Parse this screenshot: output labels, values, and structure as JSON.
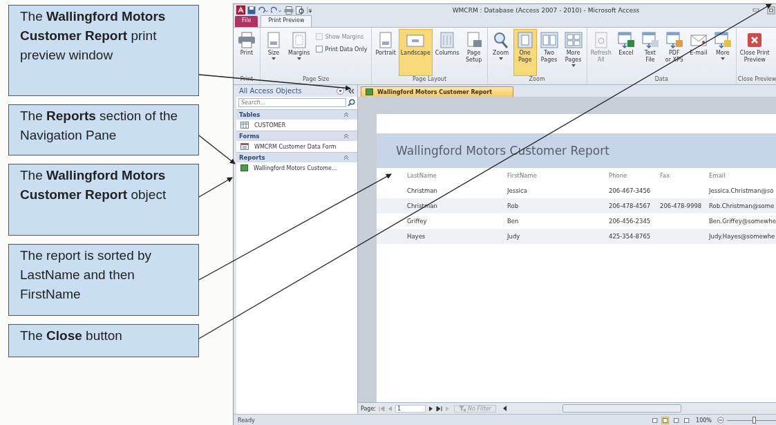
{
  "callouts": [
    {
      "text": "The **Wallingford Motors Customer Report** print preview window"
    },
    {
      "text": "The **Reports** section of the Navigation Pane"
    },
    {
      "text": "The **Wallingford Motors Customer Report** object"
    },
    {
      "text": "The report is sorted by LastName and then FirstName"
    },
    {
      "text": "The **Close** button"
    }
  ],
  "window": {
    "title": "WMCRM : Database (Access 2007 - 2010) - Microsoft Access"
  },
  "tabs": [
    {
      "label": "File",
      "kind": "file",
      "selected": false
    },
    {
      "label": "Print Preview",
      "kind": "ribbon",
      "selected": true
    }
  ],
  "ribbon_groups": [
    {
      "label": "Print",
      "items": [
        {
          "kind": "large",
          "label": "Print",
          "selected": false,
          "disabled": false,
          "menu": false
        }
      ]
    },
    {
      "label": "Page Size",
      "items": [
        {
          "kind": "large",
          "label": "Size",
          "selected": false,
          "disabled": false,
          "menu": true
        },
        {
          "kind": "large",
          "label": "Margins",
          "selected": false,
          "disabled": false,
          "menu": true
        },
        {
          "kind": "check",
          "label": "Show Margins",
          "checked": false,
          "disabled": true
        },
        {
          "kind": "check",
          "label": "Print Data Only",
          "checked": false,
          "disabled": false
        }
      ]
    },
    {
      "label": "Page Layout",
      "items": [
        {
          "kind": "large",
          "label": "Portrait",
          "selected": false,
          "disabled": false,
          "menu": false
        },
        {
          "kind": "large",
          "label": "Landscape",
          "selected": true,
          "disabled": false,
          "menu": false
        },
        {
          "kind": "large",
          "label": "Columns",
          "selected": false,
          "disabled": false,
          "menu": false
        },
        {
          "kind": "large",
          "label": "Page\nSetup",
          "selected": false,
          "disabled": false,
          "menu": false
        }
      ]
    },
    {
      "label": "Zoom",
      "items": [
        {
          "kind": "large",
          "label": "Zoom",
          "selected": false,
          "disabled": false,
          "menu": true
        },
        {
          "kind": "large",
          "label": "One\nPage",
          "selected": true,
          "disabled": false,
          "menu": false
        },
        {
          "kind": "large",
          "label": "Two\nPages",
          "selected": false,
          "disabled": false,
          "menu": false
        },
        {
          "kind": "large",
          "label": "More\nPages",
          "selected": false,
          "disabled": false,
          "menu": true
        }
      ]
    },
    {
      "label": "Data",
      "items": [
        {
          "kind": "large",
          "label": "Refresh\nAll",
          "selected": false,
          "disabled": true,
          "menu": false
        },
        {
          "kind": "large",
          "label": "Excel",
          "selected": false,
          "disabled": false,
          "menu": false
        },
        {
          "kind": "large",
          "label": "Text\nFile",
          "selected": false,
          "disabled": false,
          "menu": false
        },
        {
          "kind": "large",
          "label": "PDF\nor XPS",
          "selected": false,
          "disabled": false,
          "menu": false
        },
        {
          "kind": "large",
          "label": "E-mail",
          "selected": false,
          "disabled": false,
          "menu": false
        },
        {
          "kind": "large",
          "label": "More",
          "selected": false,
          "disabled": false,
          "menu": true
        }
      ]
    },
    {
      "label": "Close Preview",
      "items": [
        {
          "kind": "large",
          "label": "Close Print\nPreview",
          "selected": false,
          "disabled": false,
          "menu": false
        }
      ]
    }
  ],
  "nav_pane": {
    "title": "All Access Objects",
    "search": {
      "placeholder": "Search..."
    },
    "sections": [
      {
        "label": "Tables",
        "expanded": true,
        "items": [
          {
            "label": "CUSTOMER"
          }
        ]
      },
      {
        "label": "Forms",
        "expanded": true,
        "items": [
          {
            "label": "WMCRM Customer Data Form"
          }
        ]
      },
      {
        "label": "Reports",
        "expanded": true,
        "items": [
          {
            "label": "Wallingford Motors Custome..."
          }
        ]
      }
    ]
  },
  "document_tabs": [
    {
      "label": "Wallingford Motors Customer Report",
      "selected": true
    }
  ],
  "report": {
    "title": "Wallingford Motors Customer Report",
    "columns": [
      "LastName",
      "FirstName",
      "Phone",
      "Fax",
      "Email"
    ],
    "rows": [
      [
        "Christman",
        "Jessica",
        "206-467-3456",
        "",
        "Jessica.Christman@so"
      ],
      [
        "Christman",
        "Rob",
        "206-478-4567",
        "206-478-9998",
        "Rob.Christman@some"
      ],
      [
        "Griffey",
        "Ben",
        "206-456-2345",
        "",
        "Ben.Griffey@somewhe"
      ],
      [
        "Hayes",
        "Judy",
        "425-354-8765",
        "",
        "Judy.Hayes@somewhe"
      ]
    ]
  },
  "record_nav": {
    "label": "Page:",
    "value": "1",
    "filter": "No Filter"
  },
  "status_bar": {
    "text": "Ready",
    "views": [
      {
        "selected": false
      },
      {
        "selected": true
      },
      {
        "selected": false
      },
      {
        "selected": false
      }
    ],
    "zoom": "100%",
    "zoom_slider": {
      "level": 0.5
    }
  }
}
